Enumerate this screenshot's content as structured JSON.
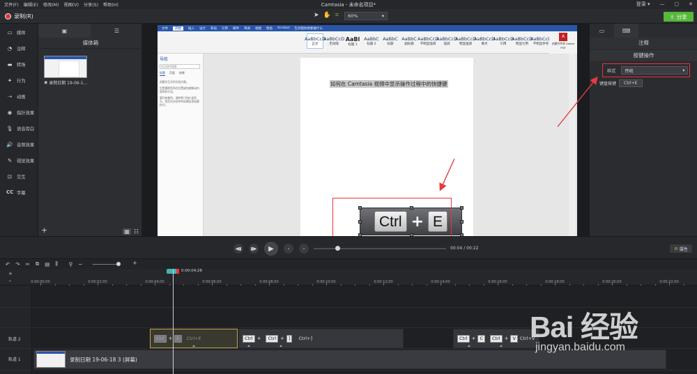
{
  "app": {
    "title": "Camtasia - 未命名项目*",
    "menus": [
      "文件(F)",
      "编辑(E)",
      "修改(M)",
      "视图(V)",
      "分享(S)",
      "帮助(H)"
    ],
    "login": "登录",
    "window_controls": [
      "—",
      "▢",
      "✕"
    ]
  },
  "toolbar": {
    "record_label": "录制(R)",
    "zoom_value": "60%",
    "share_label": "分享",
    "accent_green": "#58b83b",
    "record_red": "#e03535"
  },
  "leftnav": {
    "items": [
      {
        "icon": "media-icon",
        "label": "媒体"
      },
      {
        "icon": "annotation-icon",
        "label": "注释"
      },
      {
        "icon": "transition-icon",
        "label": "转场"
      },
      {
        "icon": "behavior-icon",
        "label": "行为"
      },
      {
        "icon": "animation-icon",
        "label": "动画"
      },
      {
        "icon": "cursor-effects-icon",
        "label": "指针效果"
      },
      {
        "icon": "voice-narration-icon",
        "label": "语音旁白"
      },
      {
        "icon": "audio-effects-icon",
        "label": "音频效果"
      },
      {
        "icon": "visual-effects-icon",
        "label": "视觉效果"
      },
      {
        "icon": "interactive-icon",
        "label": "交互"
      },
      {
        "icon": "captions-icon",
        "label": "字幕"
      }
    ]
  },
  "mediabin": {
    "title": "媒体箱",
    "thumb_label": "录制日期 19-06-1..."
  },
  "canvas": {
    "word": {
      "tabs": [
        "文件",
        "开始",
        "插入",
        "设计",
        "布局",
        "引用",
        "邮件",
        "审阅",
        "视图",
        "帮助",
        "Acrobat",
        "告诉我你想要做什么"
      ],
      "active_tab": "开始",
      "styles": [
        {
          "sample": "AaBbCcD",
          "name": "正文",
          "big": false
        },
        {
          "sample": "AaBbCcD",
          "name": "无间隔",
          "big": false
        },
        {
          "sample": "AaBl",
          "name": "标题 1",
          "big": true
        },
        {
          "sample": "AaBbC",
          "name": "标题 2",
          "big": false
        },
        {
          "sample": "AaBbC",
          "name": "标题",
          "big": false
        },
        {
          "sample": "AaBbC",
          "name": "副标题",
          "big": false
        },
        {
          "sample": "AaBbCcD",
          "name": "不明显强调",
          "big": false
        },
        {
          "sample": "AaBbCcD",
          "name": "强调",
          "big": false
        },
        {
          "sample": "AaBbCcD",
          "name": "明显强调",
          "big": false
        },
        {
          "sample": "AaBbCcD",
          "name": "要点",
          "big": false
        },
        {
          "sample": "AaBbCcD",
          "name": "引用",
          "big": false
        },
        {
          "sample": "AaBbCcD",
          "name": "明显引用",
          "big": false
        },
        {
          "sample": "AaBbCcD",
          "name": "不明显参考",
          "big": false
        }
      ],
      "pane_title": "导航",
      "pane_search": "在文档中搜索",
      "pane_tabs": [
        "标题",
        "页面",
        "结果"
      ],
      "pane_texts": [
        "创建交互式的文档大纲。",
        "它是跟踪您所在位置或快速移动内容的好方法。",
        "要开始使用，请转到\"开始\"选项卡，然后向文档中的标题应用标题样式。"
      ],
      "doc_line": "如何在 Camtasia 视频中显示操作过程中的快捷键",
      "pdf_label": "创建并共享 Adobe PDF"
    },
    "overlay_keys": [
      "Ctrl",
      "+",
      "E"
    ]
  },
  "props": {
    "title": "注释",
    "subtitle": "按键操作",
    "style_label": "样式",
    "style_value": "传统",
    "keys_label": "键盘按键",
    "keys_value": "Ctrl+E"
  },
  "playback": {
    "time_current": "00:04",
    "time_sep": "/",
    "time_total": "00:22",
    "progress": 0.18,
    "props_button": "属性"
  },
  "timeline": {
    "playhead_time": "0:00:04;28",
    "ruler_labels": [
      "0:00:00;00",
      "0:00:02;00",
      "0:00:04;00",
      "0:00:06;00",
      "0:00:08;00",
      "0:00:10;00",
      "0:00:12;00",
      "0:00:14;00",
      "0:00:16;00",
      "0:00:18;00",
      "0:00:20;00",
      "0:00:22;00"
    ],
    "tracks": [
      "轨道 2",
      "轨道 1"
    ],
    "ghost_clip": {
      "k1": "Ctrl",
      "plus": "+",
      "k2": "E",
      "text": "Ctrl+E"
    },
    "clip2": {
      "k1": "Ctrl",
      "plus": "+",
      "k2": "Ctrl",
      "plus2": "+",
      "k3": "]",
      "text": "Ctrl+]"
    },
    "clip3": {
      "k1": "Ctrl",
      "plus": "+",
      "k2": "C",
      "k3": "Ctrl",
      "plus2": "+",
      "k4": "V",
      "text": "Ctrl+V"
    },
    "record_clip_label": "录制日期 19-06-18 3 (屏幕)"
  },
  "watermark": {
    "text": "Bai 经验",
    "url": "jingyan.baidu.com"
  }
}
